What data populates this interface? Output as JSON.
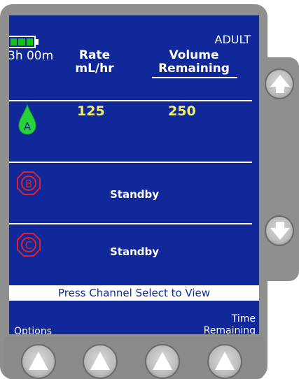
{
  "header": {
    "battery_time": "3h 00m",
    "patient_mode": "ADULT",
    "rate_header": [
      "Rate",
      "mL/hr"
    ],
    "volume_header": [
      "Volume",
      "Remaining"
    ]
  },
  "channels": [
    {
      "letter": "A",
      "status": "running",
      "rate": "125",
      "volume": "250"
    },
    {
      "letter": "B",
      "status_text": "Standby"
    },
    {
      "letter": "C",
      "status_text": "Standby"
    }
  ],
  "status_message": "Press Channel Select to View",
  "softkeys": {
    "left": "Options",
    "right": [
      "Time",
      "Remaining"
    ]
  },
  "colors": {
    "screen_bg": "#10289a",
    "running": "#27d33a",
    "value_text": "#f2ef6a",
    "stop_icon": "#e0202a"
  },
  "icons": {
    "battery": "battery-icon",
    "channel_a": "droplet-icon",
    "channel_b": "octagon-stop-icon",
    "channel_c": "octagon-stop-icon",
    "up_arrow": "up-arrow-icon",
    "down_arrow": "down-arrow-icon"
  }
}
